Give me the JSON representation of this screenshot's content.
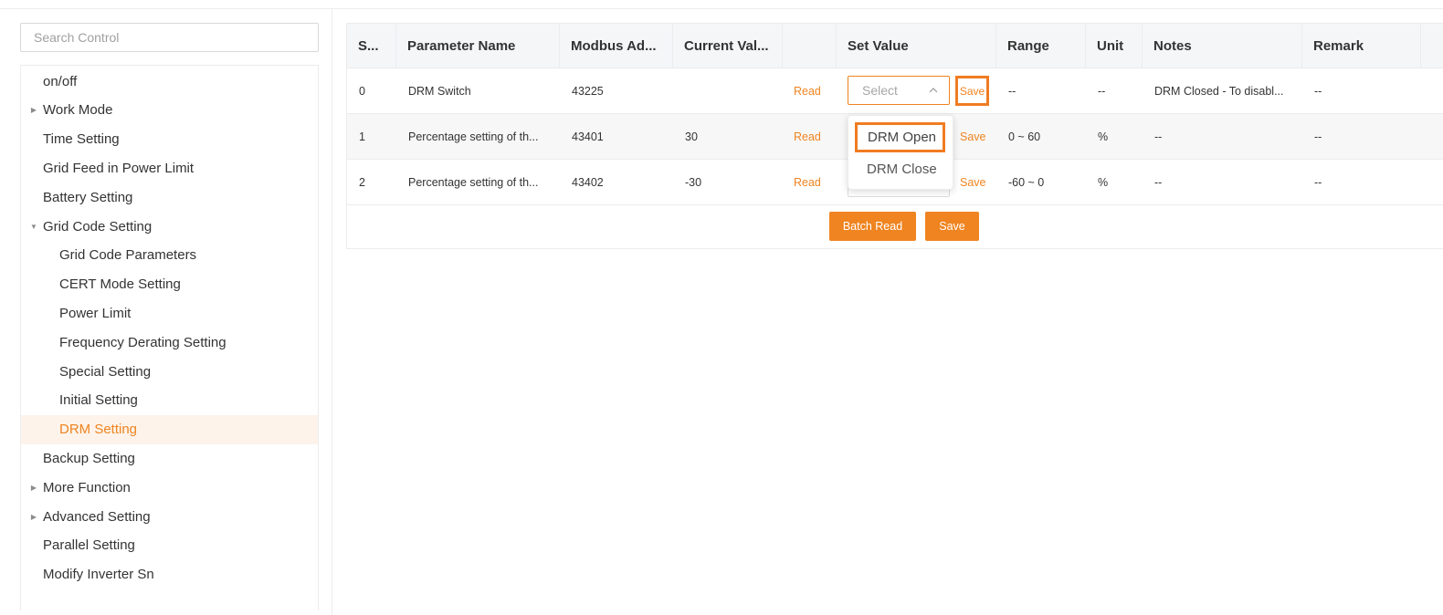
{
  "sidebar": {
    "search_placeholder": "Search Control",
    "items": [
      {
        "label": "on/off",
        "level": 0,
        "arrow": "",
        "active": false
      },
      {
        "label": "Work Mode",
        "level": 0,
        "arrow": "caret-right-icon",
        "active": false
      },
      {
        "label": "Time Setting",
        "level": 0,
        "arrow": "",
        "active": false
      },
      {
        "label": "Grid Feed in Power Limit",
        "level": 0,
        "arrow": "",
        "active": false
      },
      {
        "label": "Battery Setting",
        "level": 0,
        "arrow": "",
        "active": false
      },
      {
        "label": "Grid Code Setting",
        "level": 0,
        "arrow": "caret-down-icon",
        "active": false
      },
      {
        "label": "Grid Code Parameters",
        "level": 1,
        "arrow": "",
        "active": false
      },
      {
        "label": "CERT Mode Setting",
        "level": 1,
        "arrow": "",
        "active": false
      },
      {
        "label": "Power Limit",
        "level": 1,
        "arrow": "",
        "active": false
      },
      {
        "label": "Frequency Derating Setting",
        "level": 1,
        "arrow": "",
        "active": false
      },
      {
        "label": "Special Setting",
        "level": 1,
        "arrow": "",
        "active": false
      },
      {
        "label": "Initial Setting",
        "level": 1,
        "arrow": "",
        "active": false
      },
      {
        "label": "DRM Setting",
        "level": 1,
        "arrow": "",
        "active": true
      },
      {
        "label": "Backup Setting",
        "level": 0,
        "arrow": "",
        "active": false
      },
      {
        "label": "More Function",
        "level": 0,
        "arrow": "caret-right-icon",
        "active": false
      },
      {
        "label": "Advanced Setting",
        "level": 0,
        "arrow": "caret-right-icon",
        "active": false
      },
      {
        "label": "Parallel Setting",
        "level": 0,
        "arrow": "",
        "active": false
      },
      {
        "label": "Modify Inverter Sn",
        "level": 0,
        "arrow": "",
        "active": false
      }
    ]
  },
  "table": {
    "headers": {
      "serial": "S...",
      "param": "Parameter Name",
      "modbus": "Modbus Ad...",
      "current": "Current Val...",
      "action": "",
      "set_value": "Set Value",
      "range": "Range",
      "unit": "Unit",
      "notes": "Notes",
      "remark": "Remark"
    },
    "rows": [
      {
        "serial": "0",
        "param": "DRM Switch",
        "modbus": "43225",
        "current": "",
        "read": "Read",
        "select_placeholder": "Select",
        "save": "Save",
        "range": "--",
        "unit": "--",
        "notes": "DRM Closed - To disabl...",
        "remark": "--"
      },
      {
        "serial": "1",
        "param": "Percentage setting of th...",
        "modbus": "43401",
        "current": "30",
        "read": "Read",
        "save": "Save",
        "range": "0 ~ 60",
        "unit": "%",
        "notes": "--",
        "remark": "--"
      },
      {
        "serial": "2",
        "param": "Percentage setting of th...",
        "modbus": "43402",
        "current": "-30",
        "read": "Read",
        "save": "Save",
        "range": "-60 ~ 0",
        "unit": "%",
        "notes": "--",
        "remark": "--"
      }
    ],
    "batch_read_label": "Batch Read",
    "save_label": "Save"
  },
  "dropdown": {
    "options": [
      "DRM Open",
      "DRM Close"
    ],
    "highlighted": "DRM Open"
  },
  "colors": {
    "accent": "#ef8420",
    "highlight_border": "#f07c22",
    "active_bg": "#fdf3ea"
  }
}
